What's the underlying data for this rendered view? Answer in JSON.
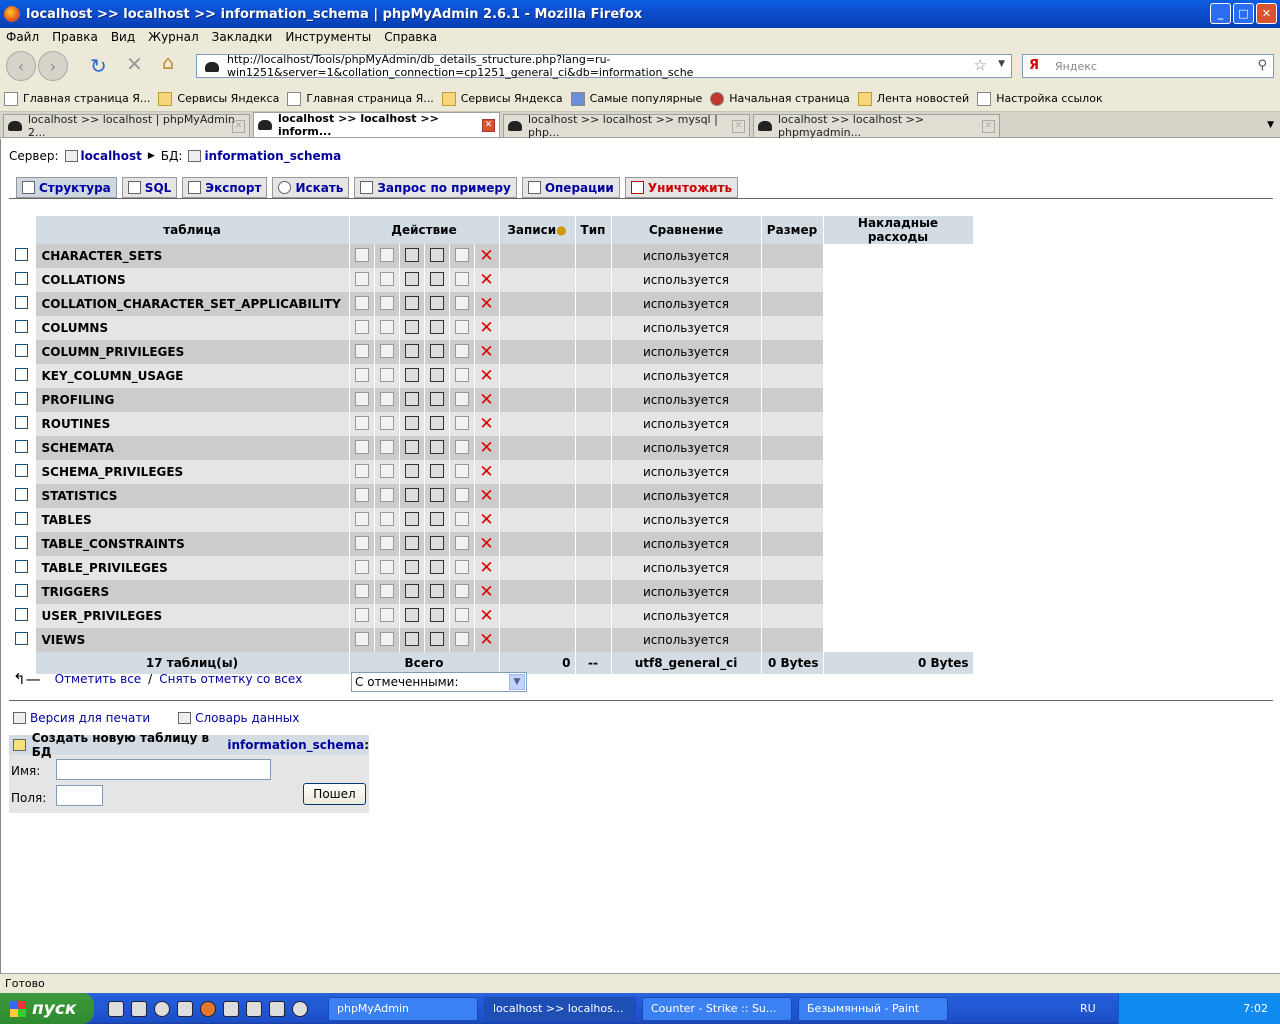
{
  "window": {
    "title": "localhost >> localhost >> information_schema | phpMyAdmin 2.6.1 - Mozilla Firefox"
  },
  "menu": [
    "Файл",
    "Правка",
    "Вид",
    "Журнал",
    "Закладки",
    "Инструменты",
    "Справка"
  ],
  "nav": {
    "url": "http://localhost/Tools/phpMyAdmin/db_details_structure.php?lang=ru-win1251&server=1&collation_connection=cp1251_general_ci&db=information_sche",
    "search_placeholder": "Яндекс"
  },
  "bookmarks": [
    {
      "label": "Главная страница Я...",
      "icon": "page-icon"
    },
    {
      "label": "Сервисы Яндекса",
      "icon": "folder-icon"
    },
    {
      "label": "Главная страница Я...",
      "icon": "page-icon"
    },
    {
      "label": "Сервисы Яндекса",
      "icon": "folder-icon"
    },
    {
      "label": "Самые популярные",
      "icon": "star-icon"
    },
    {
      "label": "Начальная страница",
      "icon": "firefox-icon"
    },
    {
      "label": "Лента новостей",
      "icon": "rss-icon"
    },
    {
      "label": "Настройка ссылок",
      "icon": "page-icon"
    }
  ],
  "tabs": [
    {
      "label": "localhost >> localhost | phpMyAdmin 2..."
    },
    {
      "label": "localhost >> localhost >> inform..."
    },
    {
      "label": "localhost >> localhost >> mysql | php..."
    },
    {
      "label": "localhost >> localhost >> phpmyadmin..."
    }
  ],
  "crumb": {
    "server_label": "Сервер:",
    "server": "localhost",
    "db_label": "БД:",
    "db": "information_schema"
  },
  "toptabs": [
    "Структура",
    "SQL",
    "Экспорт",
    "Искать",
    "Запрос по примеру",
    "Операции",
    "Уничтожить"
  ],
  "table": {
    "headers": [
      "таблица",
      "Действие",
      "Записи",
      "Тип",
      "Сравнение",
      "Размер",
      "Накладные расходы"
    ],
    "rows": [
      "CHARACTER_SETS",
      "COLLATIONS",
      "COLLATION_CHARACTER_SET_APPLICABILITY",
      "COLUMNS",
      "COLUMN_PRIVILEGES",
      "KEY_COLUMN_USAGE",
      "PROFILING",
      "ROUTINES",
      "SCHEMATA",
      "SCHEMA_PRIVILEGES",
      "STATISTICS",
      "TABLES",
      "TABLE_CONSTRAINTS",
      "TABLE_PRIVILEGES",
      "TRIGGERS",
      "USER_PRIVILEGES",
      "VIEWS"
    ],
    "in_use": "используется",
    "footer": {
      "count": "17 таблиц(ы)",
      "total": "Всего",
      "records": "0",
      "type": "--",
      "collation": "utf8_general_ci",
      "size": "0 Bytes",
      "overhead": "0 Bytes"
    }
  },
  "below": {
    "check_all": "Отметить все",
    "sep": "/",
    "uncheck_all": "Снять отметку со всех",
    "with_selected": "С отмеченными:"
  },
  "links": {
    "print": "Версия для печати",
    "dict": "Словарь данных"
  },
  "create": {
    "title": "Создать новую таблицу в БД ",
    "db": "information_schema",
    "colon": ":",
    "name_label": "Имя:",
    "fields_label": "Поля:",
    "go": "Пошел"
  },
  "status": "Готово",
  "taskbar": {
    "start": "пуск",
    "tasks": [
      "phpMyAdmin",
      "localhost >> localhos...",
      "Counter - Strike :: Su...",
      "Безымянный - Paint"
    ],
    "lang": "RU",
    "time": "7:02"
  }
}
